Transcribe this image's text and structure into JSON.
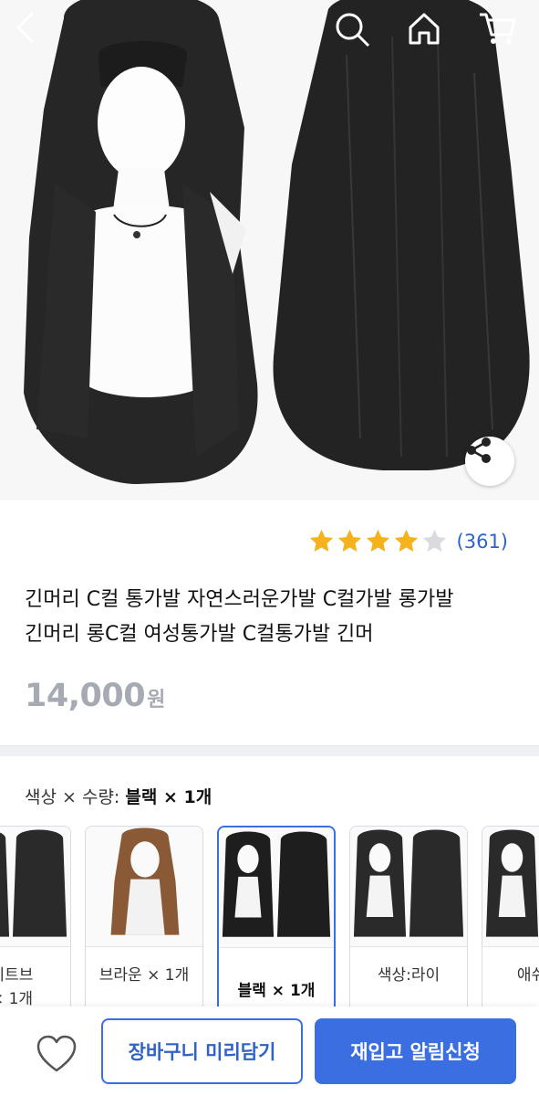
{
  "product": {
    "rating_count": "(361)",
    "rating_value": 4,
    "rating_max": 5,
    "title_line1": "긴머리 C컬 통가발 자연스러운가발 C컬가발 롱가발",
    "title_line2": "긴머리 롱C컬 여성통가발 C컬통가발 긴머",
    "price_amount": "14,000",
    "price_unit": "원"
  },
  "option": {
    "label_prefix": "색상 × 수량: ",
    "label_value": "블랙 × 1개",
    "items": [
      {
        "line1": "이트브",
        "line2": "× 1개",
        "color": "dark"
      },
      {
        "line1": "브라운 × 1개",
        "line2": "",
        "color": "brown"
      },
      {
        "line1": "블랙 × 1개",
        "line2": "",
        "color": "black",
        "selected": true
      },
      {
        "line1": "색상:라이",
        "line2": "",
        "color": "dark"
      },
      {
        "line1": "애쉬 그",
        "line2": "",
        "color": "dark"
      }
    ]
  },
  "actions": {
    "cart_label": "장바구니 미리담기",
    "notify_label": "재입고 알림신청"
  },
  "colors": {
    "accent": "#3b6ee0",
    "price": "#a6aab2",
    "star": "#f6b21b",
    "star_empty": "#d9dbdf"
  },
  "icons": {
    "back": "back-arrow-icon",
    "search": "search-icon",
    "home": "home-icon",
    "cart": "cart-icon",
    "share": "share-icon",
    "wish": "heart-icon"
  }
}
